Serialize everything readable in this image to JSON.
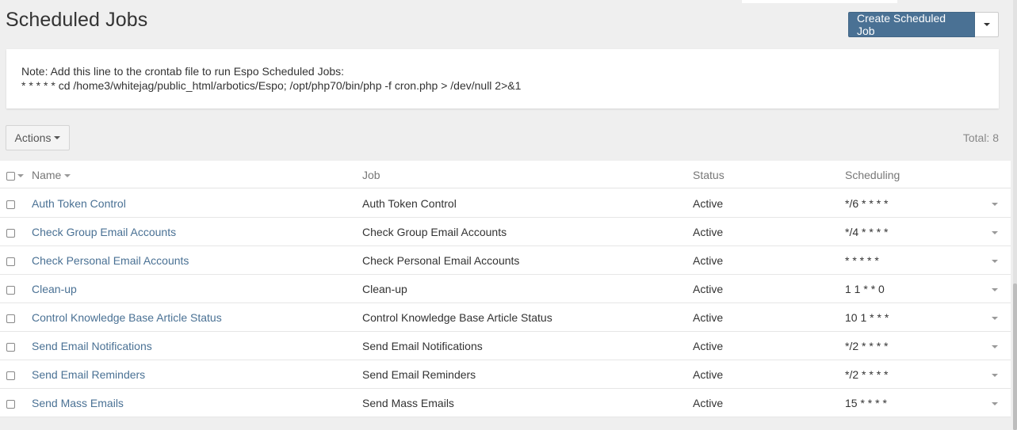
{
  "page": {
    "title": "Scheduled Jobs",
    "create_button": "Create Scheduled Job"
  },
  "note": {
    "line1": "Note: Add this line to the crontab file to run Espo Scheduled Jobs:",
    "line2": "* * * * * cd /home3/whitejag/public_html/arbotics/Espo; /opt/php70/bin/php -f cron.php > /dev/null 2>&1"
  },
  "toolbar": {
    "actions_label": "Actions",
    "total": "Total: 8"
  },
  "table": {
    "columns": [
      "Name",
      "Job",
      "Status",
      "Scheduling"
    ],
    "rows": [
      {
        "name": "Auth Token Control",
        "job": "Auth Token Control",
        "status": "Active",
        "scheduling": "*/6 * * * *"
      },
      {
        "name": "Check Group Email Accounts",
        "job": "Check Group Email Accounts",
        "status": "Active",
        "scheduling": "*/4 * * * *"
      },
      {
        "name": "Check Personal Email Accounts",
        "job": "Check Personal Email Accounts",
        "status": "Active",
        "scheduling": "* * * * *"
      },
      {
        "name": "Clean-up",
        "job": "Clean-up",
        "status": "Active",
        "scheduling": "1 1 * * 0"
      },
      {
        "name": "Control Knowledge Base Article Status",
        "job": "Control Knowledge Base Article Status",
        "status": "Active",
        "scheduling": "10 1 * * *"
      },
      {
        "name": "Send Email Notifications",
        "job": "Send Email Notifications",
        "status": "Active",
        "scheduling": "*/2 * * * *"
      },
      {
        "name": "Send Email Reminders",
        "job": "Send Email Reminders",
        "status": "Active",
        "scheduling": "*/2 * * * *"
      },
      {
        "name": "Send Mass Emails",
        "job": "Send Mass Emails",
        "status": "Active",
        "scheduling": "15 * * * *"
      }
    ]
  },
  "colors": {
    "primary": "#4a7194",
    "link": "#4a7194",
    "background": "#efefef"
  }
}
